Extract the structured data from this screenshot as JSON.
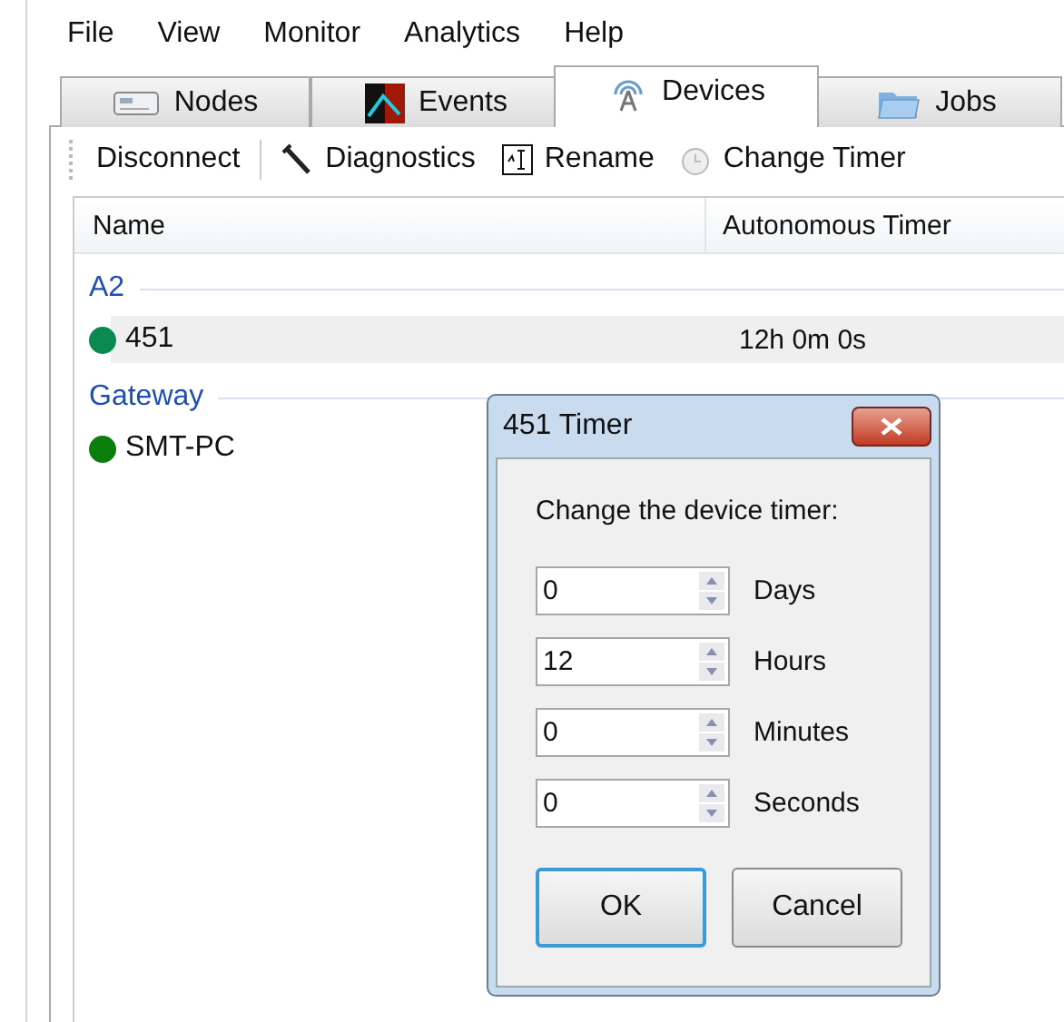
{
  "menu": [
    "File",
    "View",
    "Monitor",
    "Analytics",
    "Help"
  ],
  "tabs": [
    {
      "label": "Nodes",
      "selected": false
    },
    {
      "label": "Events",
      "selected": false
    },
    {
      "label": "Devices",
      "selected": true
    },
    {
      "label": "Jobs",
      "selected": false
    }
  ],
  "toolbar": [
    "Disconnect",
    "Diagnostics",
    "Rename",
    "Change Timer"
  ],
  "table": {
    "columns": [
      "Name",
      "Autonomous Timer"
    ],
    "groups": [
      {
        "name": "A2",
        "rows": [
          {
            "name": "451",
            "timer": "12h 0m 0s",
            "color": "#0b8a4f",
            "selected": true
          }
        ]
      },
      {
        "name": "Gateway",
        "rows": [
          {
            "name": "SMT-PC",
            "color": "#0a7d0a",
            "selected": false
          }
        ]
      }
    ]
  },
  "dialog": {
    "title": "451 Timer",
    "prompt": "Change the device timer:",
    "fields": [
      {
        "value": "0",
        "label": "Days"
      },
      {
        "value": "12",
        "label": "Hours"
      },
      {
        "value": "0",
        "label": "Minutes"
      },
      {
        "value": "0",
        "label": "Seconds"
      }
    ],
    "buttons": [
      {
        "label": "OK",
        "default": true
      },
      {
        "label": "Cancel",
        "default": false
      }
    ]
  }
}
